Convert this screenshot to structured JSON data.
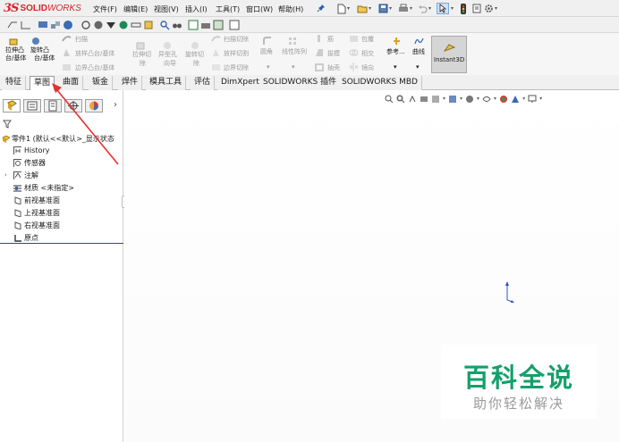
{
  "app": {
    "logo_prefix": "3S",
    "logo_solid": "SOLID",
    "logo_works": "WORKS",
    "brand_color": "#d8232a"
  },
  "menu": {
    "items": [
      "文件(F)",
      "编辑(E)",
      "视图(V)",
      "插入(I)",
      "工具(T)",
      "窗口(W)",
      "帮助(H)"
    ]
  },
  "commands": {
    "extrude_boss": "拉伸凸",
    "extrude_boss_2": "台/基体",
    "revolve_boss": "旋转凸",
    "revolve_boss_2": "台/基体",
    "sweep": "扫描",
    "loft": "放样凸台/基体",
    "boundary": "边界凸台/基体",
    "extruded_cut": "拉伸切",
    "extruded_cut_2": "除",
    "hole_wizard": "异型孔",
    "hole_wizard_2": "向导",
    "revolved_cut": "旋转切",
    "revolved_cut_2": "除",
    "swept_cut": "扫描切除",
    "lofted_cut": "放样切割",
    "boundary_cut": "边界切除",
    "fillet": "圆角",
    "linear_pattern": "线性阵列",
    "rib": "筋",
    "draft": "拔模",
    "shell": "抽壳",
    "wrap": "包覆",
    "intersect": "相交",
    "mirror": "镜向",
    "reference": "参考...",
    "curves": "曲线",
    "instant3d": "Instant3D"
  },
  "tabs": [
    "特征",
    "草图",
    "曲面",
    "钣金",
    "焊件",
    "模具工具",
    "评估",
    "DimXpert",
    "SOLIDWORKS 插件",
    "SOLIDWORKS MBD"
  ],
  "active_tab_index": 1,
  "tree": {
    "root": "零件1 (默认<<默认>_显示状态",
    "items": [
      {
        "label": "History",
        "icon": "history-icon"
      },
      {
        "label": "传感器",
        "icon": "sensor-icon"
      },
      {
        "label": "注解",
        "icon": "annotation-icon"
      },
      {
        "label": "材质 <未指定>",
        "icon": "material-icon"
      },
      {
        "label": "前视基准面",
        "icon": "plane-icon"
      },
      {
        "label": "上视基准面",
        "icon": "plane-icon"
      },
      {
        "label": "右视基准面",
        "icon": "plane-icon"
      },
      {
        "label": "原点",
        "icon": "origin-icon"
      }
    ]
  },
  "watermark": {
    "title": "百科全说",
    "subtitle": "助你轻松解决",
    "color": "#13a06b"
  }
}
